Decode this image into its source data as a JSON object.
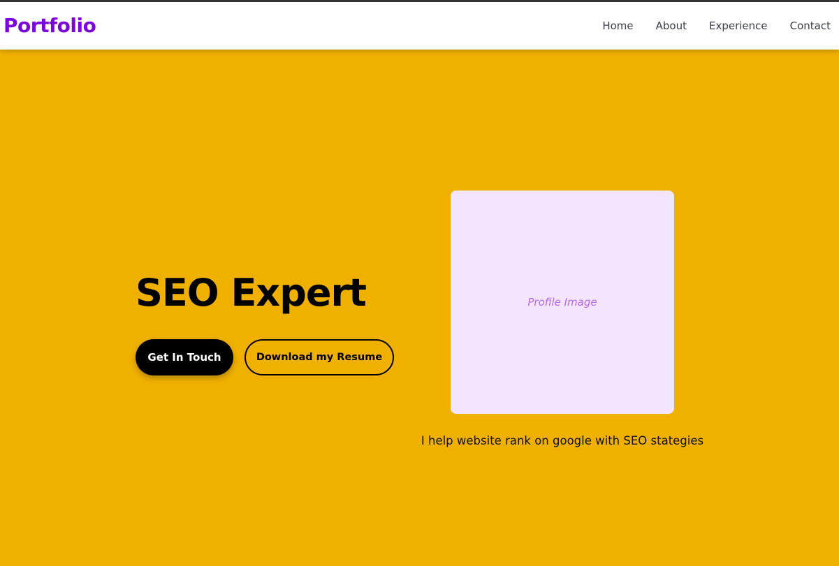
{
  "navbar": {
    "brand": "Portfolio",
    "links": [
      {
        "label": "Home"
      },
      {
        "label": "About"
      },
      {
        "label": "Experience"
      },
      {
        "label": "Contact"
      }
    ]
  },
  "hero": {
    "title": "SEO Expert",
    "primary_button": "Get In Touch",
    "secondary_button": "Download my Resume",
    "profile_placeholder": "Profile Image",
    "tagline": "I help website rank on google with SEO stategies"
  },
  "colors": {
    "background": "#f0b000",
    "brand": "#7b06d9",
    "navbar": "#ffffff",
    "profile_box": "#f3e5fd",
    "profile_text": "#b768e8",
    "primary_button": "#000000"
  }
}
